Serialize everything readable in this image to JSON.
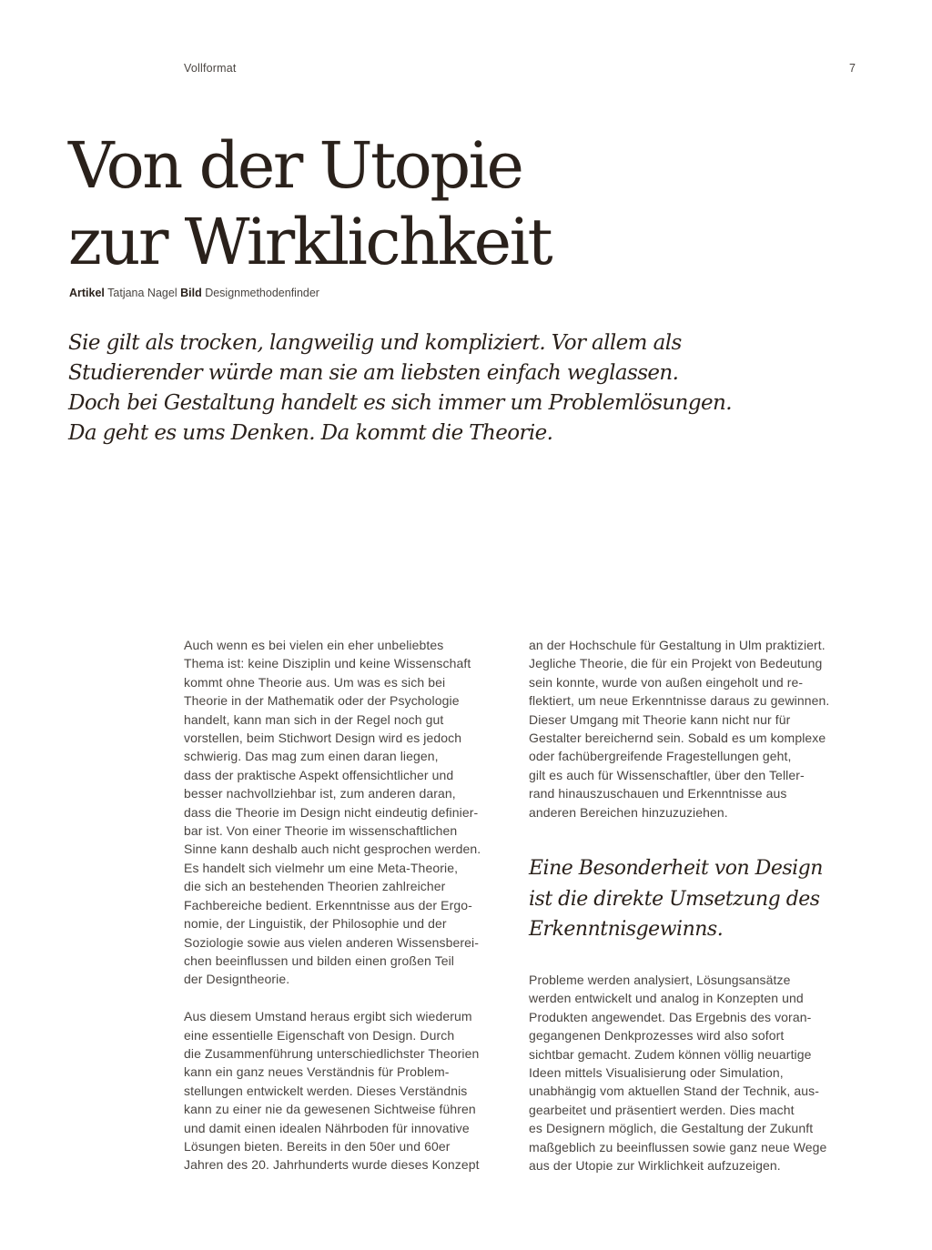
{
  "header": {
    "section": "Vollformat",
    "page_number": "7"
  },
  "article": {
    "title_lines": [
      "Von der Utopie",
      "zur Wirklichkeit"
    ],
    "credits": {
      "article_label": "Artikel",
      "author": "Tatjana Nagel",
      "image_label": "Bild",
      "image_source": "Designmethodenfinder"
    },
    "lead_lines": [
      "Sie gilt als trocken, langweilig und kompliziert. Vor allem als",
      "Studierender würde man sie am liebsten einfach weglassen.",
      "Doch bei Gestaltung handelt es sich immer um Problemlösungen.",
      "Da geht es ums Denken. Da kommt die Theorie."
    ],
    "left_column": {
      "paragraph1": [
        "Auch wenn es bei vielen ein eher unbeliebtes",
        "Thema ist: keine Disziplin und keine Wissenschaft",
        "kommt ohne Theorie aus. Um was es sich bei",
        "Theorie in der Mathematik oder der Psychologie",
        "handelt, kann man sich in der Regel noch gut",
        "vorstellen, beim Stichwort Design wird es jedoch",
        "schwierig. Das mag zum einen daran liegen,",
        "dass der praktische Aspekt offensichtlicher und",
        "besser nachvollziehbar ist, zum anderen daran,",
        "dass die Theorie im Design nicht eindeutig definier-",
        "bar ist. Von einer Theorie im wissenschaftlichen",
        "Sinne kann deshalb auch nicht gesprochen werden.",
        "Es handelt sich vielmehr um eine Meta-Theorie,",
        "die sich an bestehenden Theorien zahlreicher",
        "Fachbereiche bedient. Erkenntnisse aus der Ergo-",
        "nomie, der Linguistik, der Philosophie und der",
        "Soziologie sowie aus vielen anderen Wissensberei-",
        "chen beeinflussen und bilden einen großen Teil",
        "der Designtheorie."
      ],
      "paragraph2": [
        "Aus diesem Umstand heraus ergibt sich wiederum",
        "eine essentielle Eigenschaft von Design. Durch",
        "die Zusammenführung unterschiedlichster Theorien",
        "kann ein ganz neues Verständnis für Problem-",
        "stellungen entwickelt werden. Dieses Verständnis",
        "kann zu einer nie da gewesenen Sichtweise führen",
        "und damit einen idealen Nährboden für innovative",
        "Lösungen bieten. Bereits in den 50er und 60er",
        "Jahren des 20. Jahrhunderts wurde dieses Konzept"
      ]
    },
    "right_column": {
      "paragraph1": [
        "an der Hochschule für Gestaltung in Ulm praktiziert.",
        "Jegliche Theorie, die für ein Projekt von Bedeutung",
        "sein konnte, wurde von außen eingeholt und re-",
        "flektiert, um neue Erkenntnisse daraus zu gewinnen.",
        "Dieser Umgang mit Theorie kann nicht nur für",
        "Gestalter bereichernd sein. Sobald es um komplexe",
        "oder fachübergreifende Fragestellungen geht,",
        "gilt es auch für Wissenschaftler, über den Teller-",
        "rand hinauszuschauen und Erkenntnisse aus",
        "anderen Bereichen hinzuzuziehen."
      ],
      "pull_quote_lines": [
        "Eine Besonderheit von Design",
        "ist die direkte Umsetzung des",
        "Erkenntnisgewinns."
      ],
      "paragraph2": [
        "Probleme werden analysiert, Lösungsansätze",
        "werden entwickelt und analog in Konzepten und",
        "Produkten angewendet. Das Ergebnis des voran-",
        "gegangenen Denkprozesses wird also sofort",
        "sichtbar gemacht. Zudem können völlig neuartige",
        "Ideen mittels Visualisierung oder Simulation,",
        "unabhängig vom aktuellen Stand der Technik, aus-",
        "gearbeitet und präsentiert werden. Dies macht",
        "es Designern möglich, die Gestaltung der Zukunft",
        "maßgeblich zu beeinflussen sowie ganz neue Wege",
        "aus der Utopie zur Wirklichkeit aufzuzeigen."
      ]
    }
  }
}
